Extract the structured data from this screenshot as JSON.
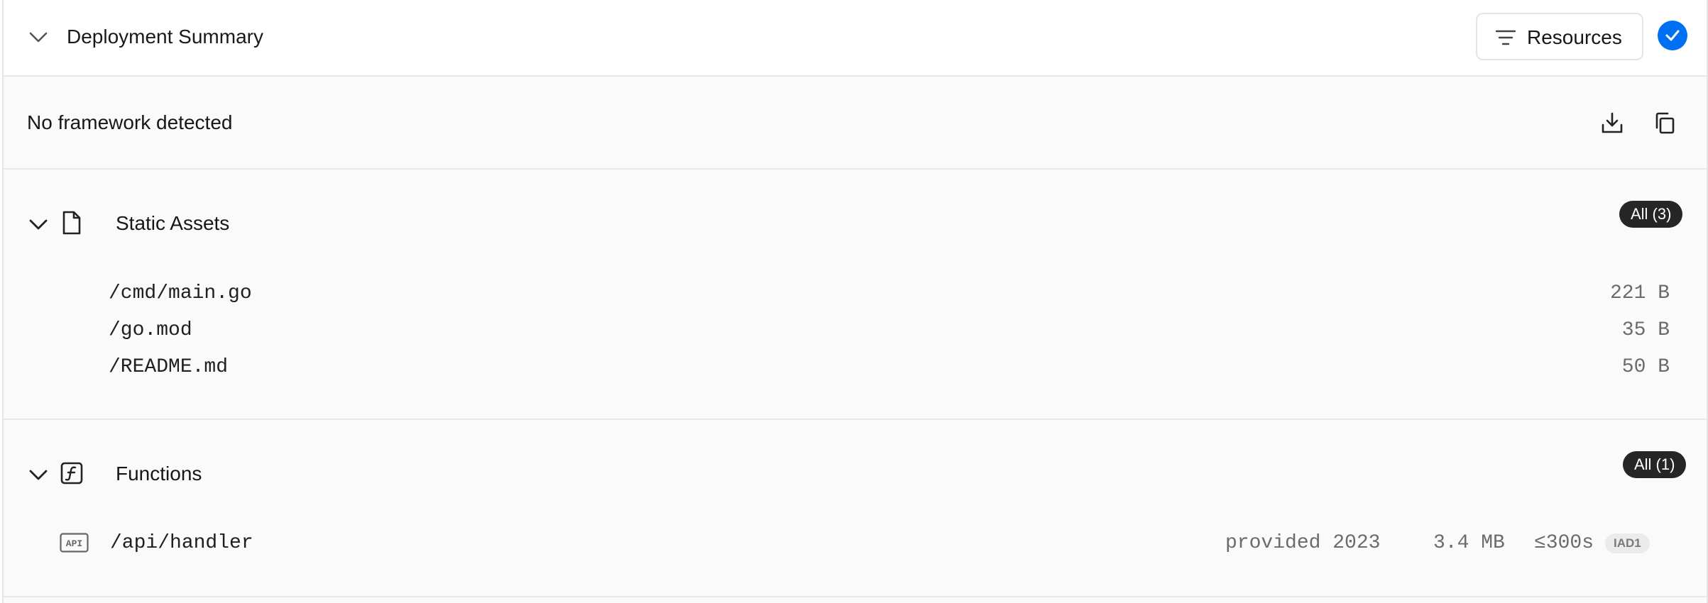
{
  "header": {
    "title": "Deployment Summary",
    "resources_label": "Resources",
    "status_color": "#0070f3"
  },
  "framework": {
    "text": "No framework detected",
    "actions": [
      "download-icon",
      "copy-icon"
    ]
  },
  "static_assets": {
    "title": "Static Assets",
    "badge": "All (3)",
    "files": [
      {
        "path": "/cmd/main.go",
        "size": "221 B"
      },
      {
        "path": "/go.mod",
        "size": "35 B"
      },
      {
        "path": "/README.md",
        "size": "50 B"
      }
    ]
  },
  "functions": {
    "title": "Functions",
    "badge": "All (1)",
    "items": [
      {
        "path": "/api/handler",
        "runtime": "provided 2023",
        "size": "3.4 MB",
        "duration": "≤300s",
        "region": "IAD1"
      }
    ]
  }
}
